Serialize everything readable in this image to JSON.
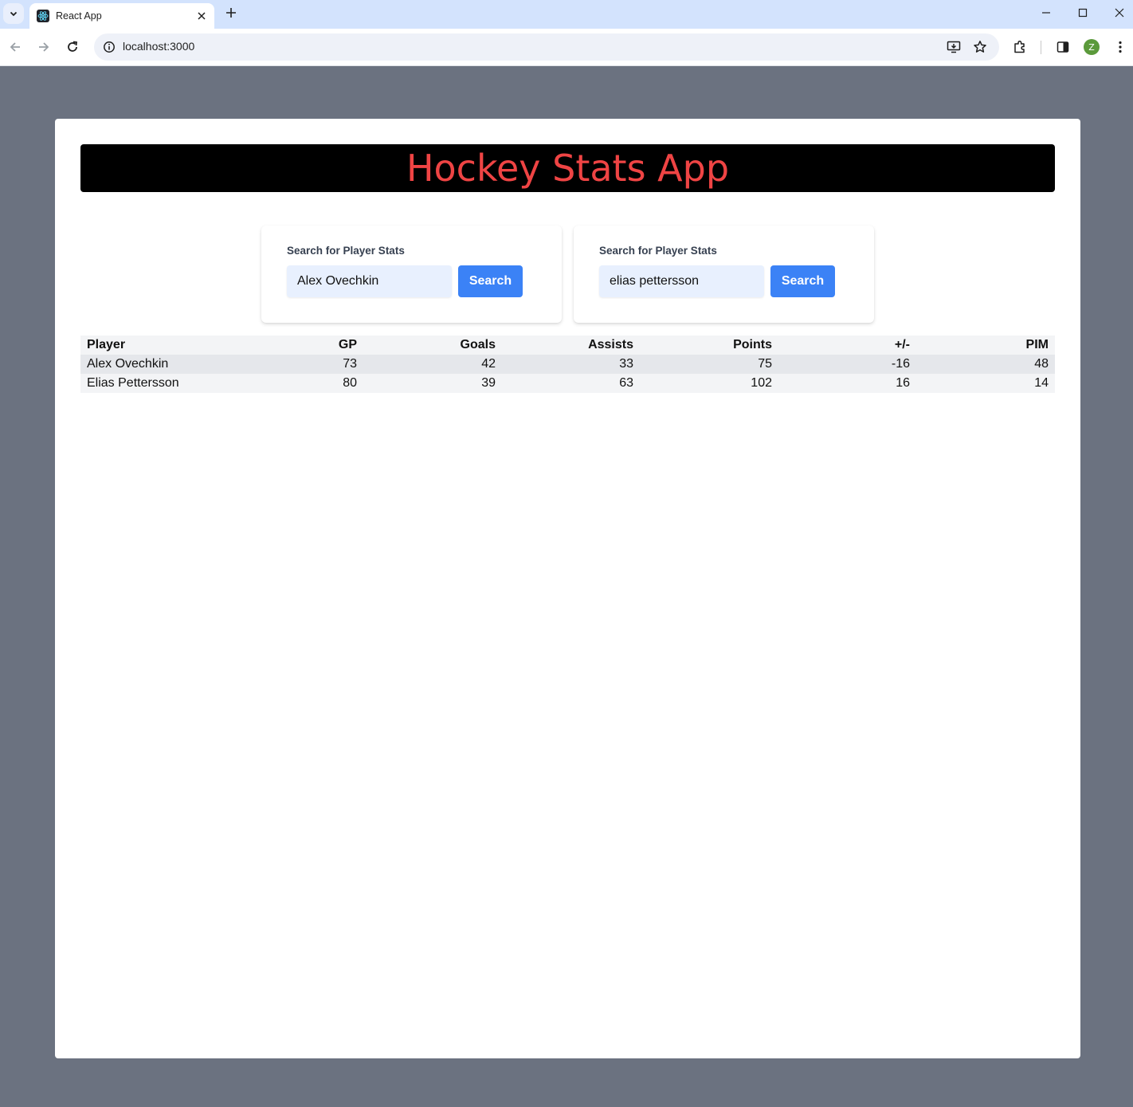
{
  "browser": {
    "tab_title": "React App",
    "url": "localhost:3000",
    "profile_initial": "Z"
  },
  "app": {
    "title": "Hockey Stats App",
    "title_color": "#ef4444",
    "accent_color": "#3b82f6"
  },
  "search_panels": [
    {
      "label": "Search for Player Stats",
      "value": "Alex Ovechkin",
      "button": "Search"
    },
    {
      "label": "Search for Player Stats",
      "value": "elias pettersson",
      "button": "Search"
    }
  ],
  "table": {
    "headers": [
      "Player",
      "GP",
      "Goals",
      "Assists",
      "Points",
      "+/-",
      "PIM"
    ],
    "rows": [
      [
        "Alex Ovechkin",
        "73",
        "42",
        "33",
        "75",
        "-16",
        "48"
      ],
      [
        "Elias Pettersson",
        "80",
        "39",
        "63",
        "102",
        "16",
        "14"
      ]
    ]
  }
}
